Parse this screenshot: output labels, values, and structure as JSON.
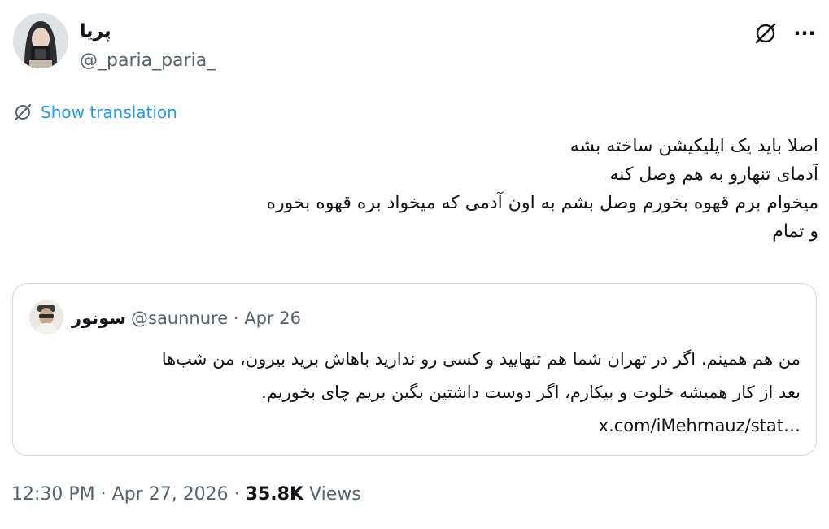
{
  "author": {
    "name": "پریا",
    "handle": "@_paria_paria_"
  },
  "header_icons": {
    "grok": "grok-icon",
    "more": "more-icon",
    "more_glyph": "···"
  },
  "translation": {
    "icon": "translate-icon",
    "label": "Show translation"
  },
  "tweet": {
    "text": "اصلا باید یک اپلیکیشن ساخته بشه\nآدمای تنهارو به هم وصل کنه\nمیخوام برم قهوه بخورم وصل بشم به اون آدمی که میخواد بره قهوه بخوره\nو تمام"
  },
  "quote": {
    "name": "سونور",
    "handle": "@saunnure",
    "separator": "·",
    "date": "Apr 26",
    "text": "من هم همینم. اگر در تهران شما هم تنهایید و کسی رو ندارید باهاش برید بیرون، من شب‌ها\nبعد از کار همیشه خلوت و بیکارم، اگر دوست داشتین بگین بریم چای بخوریم.\n…x.com/iMehrnauz/stat"
  },
  "footer": {
    "time": "12:30 PM",
    "separator": "·",
    "date": "Apr 27, 2026",
    "views_count": "35.8K",
    "views_label": "Views"
  },
  "colors": {
    "accent": "#1d9bf0",
    "secondary_text": "#536471",
    "border": "#cfd9de"
  }
}
